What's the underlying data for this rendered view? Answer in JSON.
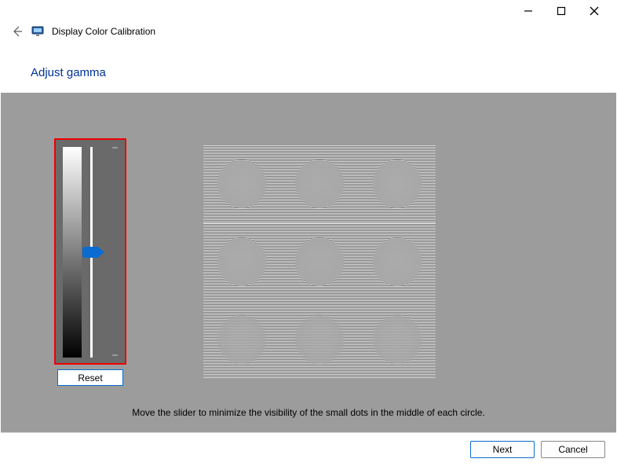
{
  "window": {
    "title": "Display Color Calibration",
    "icon": "monitor-icon"
  },
  "page": {
    "heading": "Adjust gamma",
    "instruction": "Move the slider to minimize the visibility of the small dots in the middle of each circle."
  },
  "slider": {
    "reset_label": "Reset",
    "value_percent": 50
  },
  "footer": {
    "next_label": "Next",
    "cancel_label": "Cancel"
  }
}
